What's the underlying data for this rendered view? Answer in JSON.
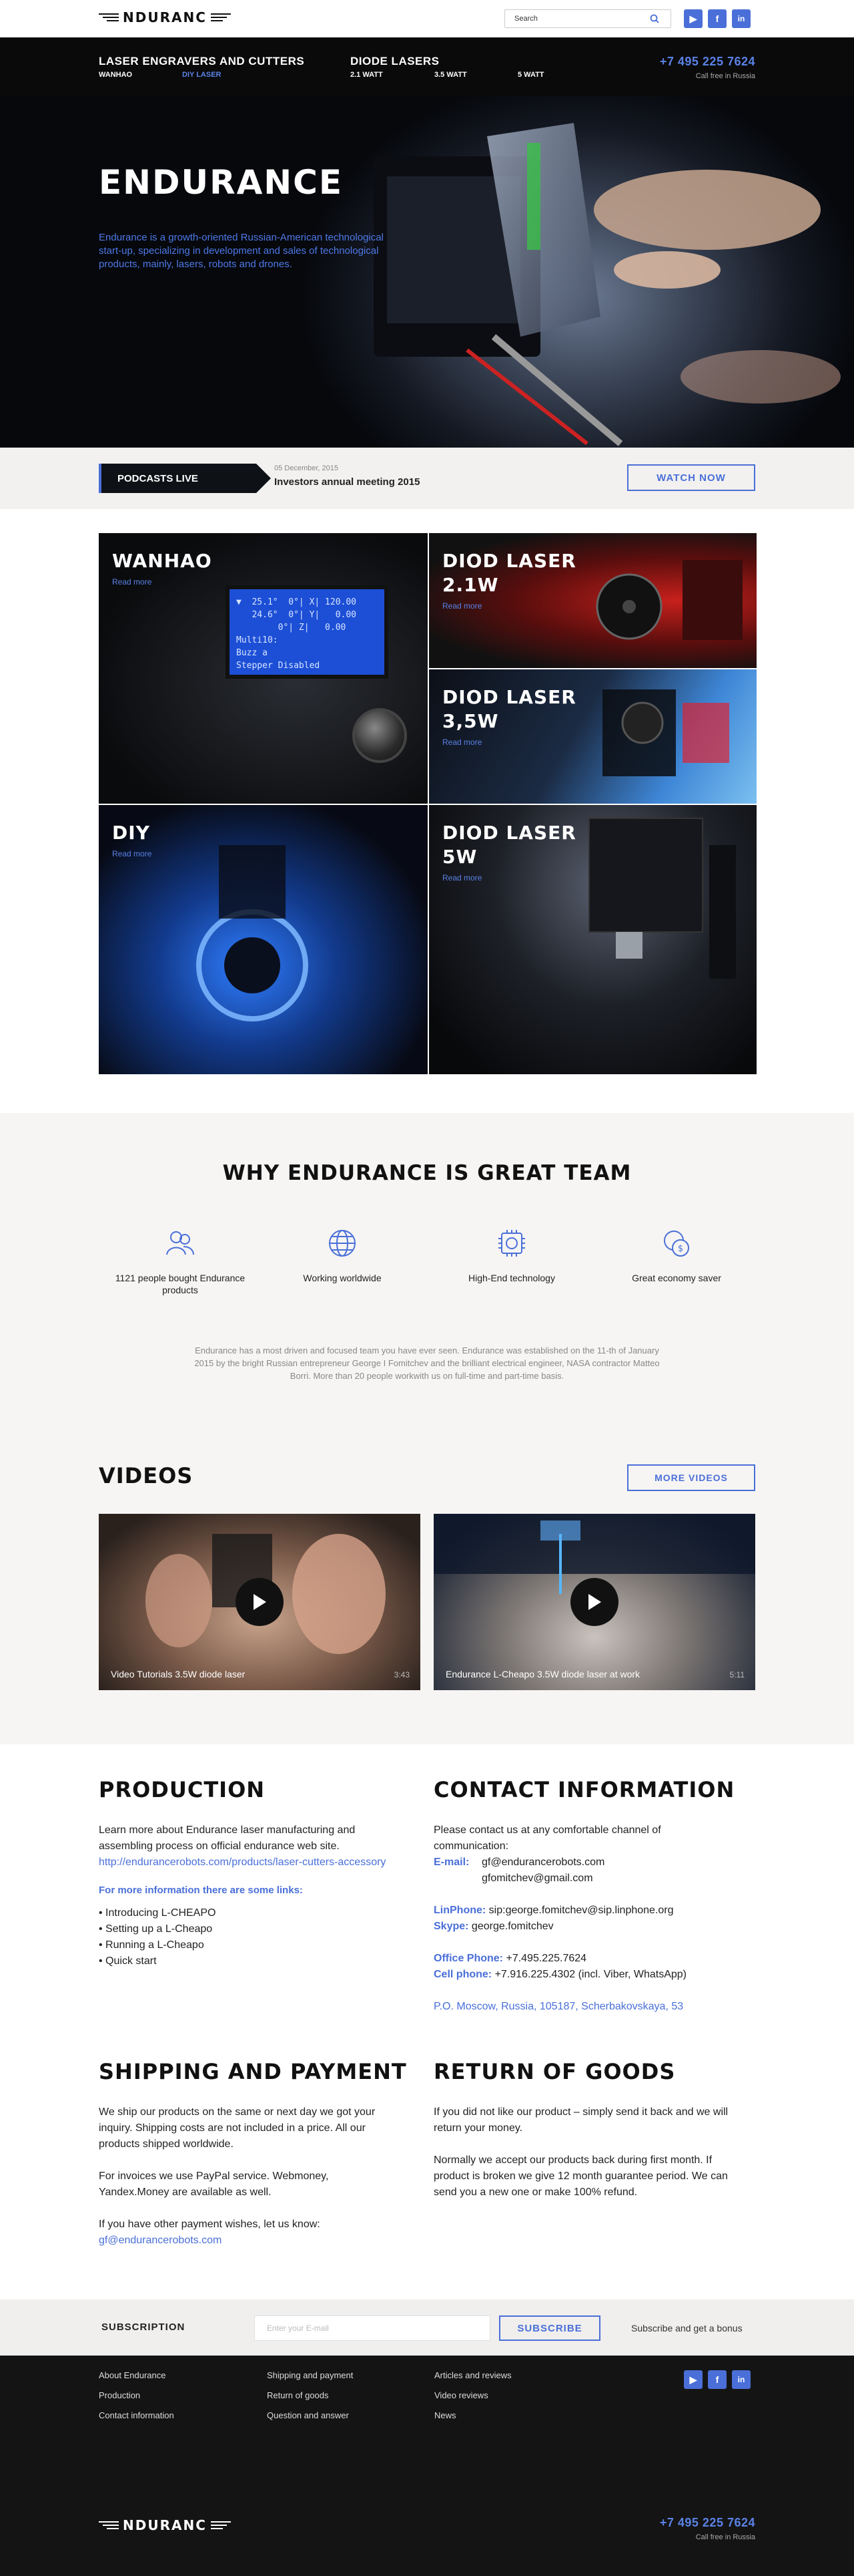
{
  "header": {
    "logo_text": "NDURANC",
    "search_placeholder": "Search",
    "social": [
      "youtube-icon",
      "facebook-icon",
      "linkedin-icon"
    ],
    "social_letters": [
      "▶",
      "f",
      "in"
    ]
  },
  "nav": {
    "categories": [
      {
        "label": "LASER ENGRAVERS AND CUTTERS",
        "items": [
          "WANHAO",
          "DIY LASER"
        ]
      },
      {
        "label": "DIODE LASERS",
        "items": [
          "2.1 WATT",
          "3.5 WATT",
          "5 WATT"
        ]
      }
    ],
    "phone": "+7 495 225 7624",
    "phone_note": "Call free in Russia"
  },
  "hero": {
    "title": "ENDURANCE",
    "text": "Endurance is a growth-oriented Russian-American technological start-up, specializing in development and sales of technological products, mainly, lasers, robots and drones."
  },
  "podcast": {
    "label": "PODCASTS LIVE",
    "date": "05 December, 2015",
    "title": "Investors annual meeting 2015",
    "button": "WATCH NOW"
  },
  "products": {
    "read_more": "Read more",
    "tiles": [
      {
        "title": "WANHAO",
        "lcd": "▼  25.1°  0°| X| 120.00\n   24.6°  0°| Y|   0.00\n        0°| Z|   0.00\nMulti10:\nBuzz a\nStepper Disabled"
      },
      {
        "title": "DIOD LASER 2.1W"
      },
      {
        "title": "DIOD LASER 3,5W"
      },
      {
        "title": "DIY"
      },
      {
        "title": "DIOD LASER 5W"
      }
    ]
  },
  "why": {
    "title": "WHY ENDURANCE IS GREAT TEAM",
    "features": [
      {
        "icon": "users-icon",
        "label": "1121 people bought Endurance products"
      },
      {
        "icon": "globe-icon",
        "label": "Working worldwide"
      },
      {
        "icon": "chip-icon",
        "label": "High-End technology"
      },
      {
        "icon": "coins-icon",
        "label": "Great economy saver"
      }
    ],
    "description": "Endurance has a most driven and focused team you have ever seen. Endurance was established on the 11-th of January 2015 by the bright Russian entrepreneur George I Fomitchev and the brilliant electrical engineer, NASA contractor Matteo Borri. More than 20 people workwith us on full-time and part-time basis."
  },
  "videos": {
    "title": "VIDEOS",
    "more": "MORE VIDEOS",
    "items": [
      {
        "caption": "Video Tutorials 3.5W diode laser",
        "duration": "3:43"
      },
      {
        "caption": "Endurance L-Cheapo 3.5W diode laser at work",
        "duration": "5:11"
      }
    ]
  },
  "production": {
    "title": "PRODUCTION",
    "text": "Learn more about Endurance laser manufacturing and assembling process on official endurance web site.",
    "url": "http://endurancerobots.com/products/laser-cutters-accessory",
    "links_title": "For more information there are some links:",
    "links": [
      "Introducing L-CHEAPO",
      "Setting up a L-Cheapo",
      "Running a L-Cheapo",
      "Quick start"
    ]
  },
  "contact": {
    "title": "CONTACT INFORMATION",
    "intro": "Please contact us at any comfortable channel of communication:",
    "email_label": "E-mail:",
    "emails": [
      "gf@endurancerobots.com",
      "gfomitchev@gmail.com"
    ],
    "linphone_label": "LinPhone:",
    "linphone": "sip:george.fomitchev@sip.linphone.org",
    "skype_label": "Skype:",
    "skype": "george.fomitchev",
    "office_label": "Office Phone:",
    "office": "+7.495.225.7624",
    "cell_label": "Cell phone:",
    "cell": "+7.916.225.4302 (incl. Viber, WhatsApp)",
    "address": "P.O. Moscow, Russia, 105187, Scherbakovskaya, 53"
  },
  "shipping": {
    "title": "SHIPPING AND PAYMENT",
    "p1": "We ship our products on the same or next day we got your inquiry. Shipping costs are not included in a price. All our products shipped worldwide.",
    "p2": "For invoices we use PayPal service. Webmoney, Yandex.Money are available as well.",
    "p3": "If you have other payment wishes, let us know:",
    "email": "gf@endurancerobots.com"
  },
  "returns": {
    "title": "RETURN OF GOODS",
    "p1": "If you did not like our product – simply send it back and we will return your money.",
    "p2": "Normally we accept our products back during first month. If product is broken we give 12 month guarantee period. We can send you a new one or make 100% refund."
  },
  "subscription": {
    "label": "SUBSCRIPTION",
    "placeholder": "Enter your E-mail",
    "button": "SUBSCRIBE",
    "note": "Subscribe and get a bonus"
  },
  "footer": {
    "col1": [
      "About Endurance",
      "Production",
      "Contact information"
    ],
    "col2": [
      "Shipping and payment",
      "Return of goods",
      "Question and answer"
    ],
    "col3": [
      "Articles and reviews",
      "Video reviews",
      "News"
    ],
    "phone": "+7 495 225 7624",
    "phone_note": "Call free in Russia"
  },
  "colors": {
    "accent": "#4a6fd8",
    "dark": "#0a0a0a",
    "light_bg": "#f6f5f4"
  }
}
